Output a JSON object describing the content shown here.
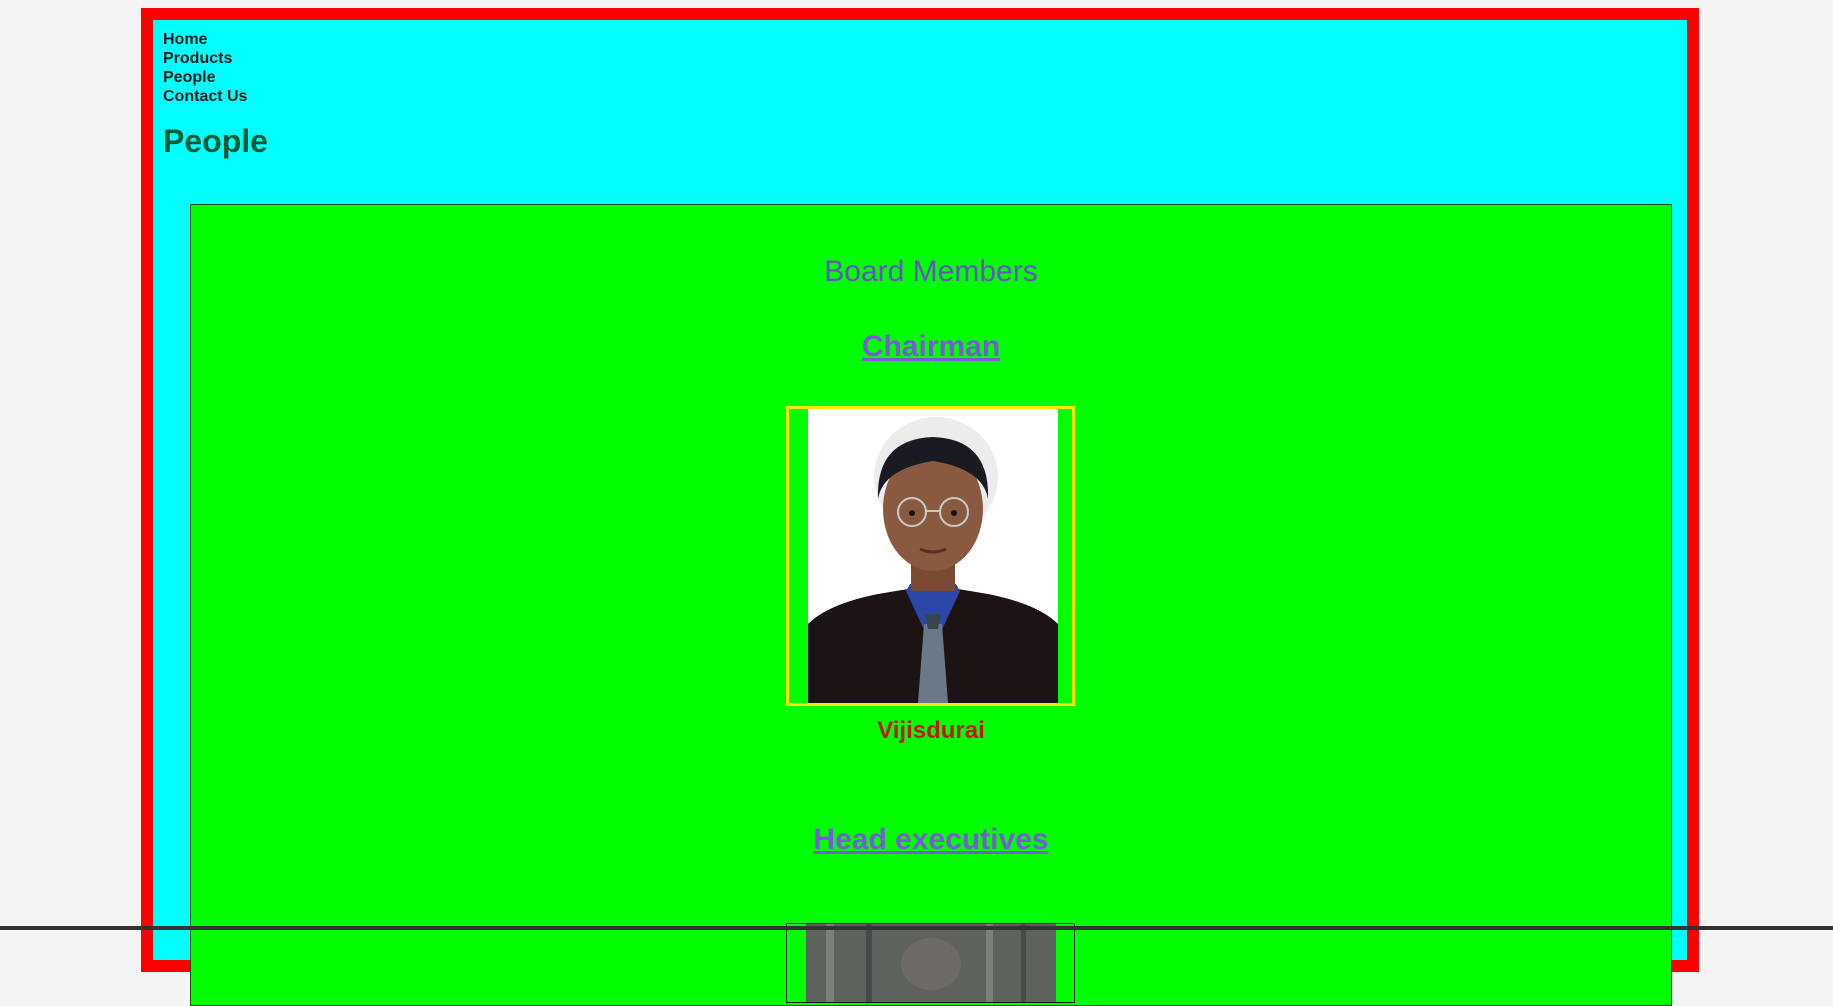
{
  "nav": {
    "items": [
      {
        "label": "Home"
      },
      {
        "label": "Products"
      },
      {
        "label": "People"
      },
      {
        "label": "Contact Us"
      }
    ]
  },
  "page": {
    "title": "People"
  },
  "content": {
    "section_heading": "Board Members",
    "chairman": {
      "heading": "Chairman",
      "name": "Vijisdurai"
    },
    "head_executives": {
      "heading": "Head executives"
    }
  },
  "colors": {
    "outer_border": "#ff0000",
    "outer_background": "#00ffff",
    "content_background": "#00ff00",
    "heading_purple": "#7a5ad8",
    "name_red": "#c8151b",
    "photo_border": "#ffe800"
  }
}
